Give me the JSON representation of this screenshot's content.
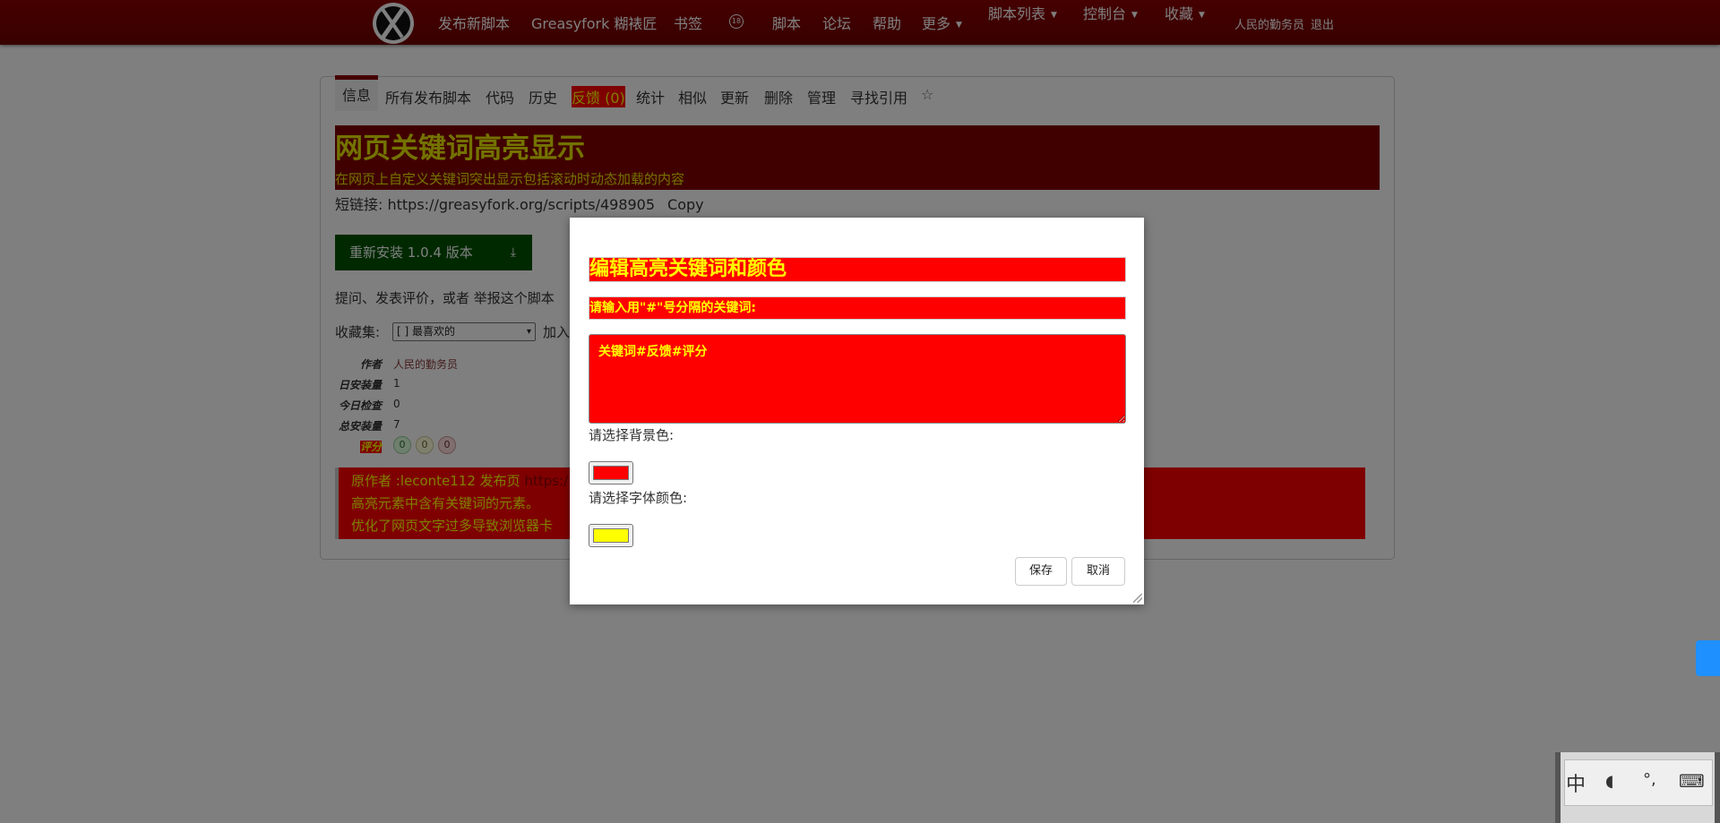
{
  "nav": {
    "items": [
      "发布新脚本",
      "Greasyfork 糊裱匠",
      "书签",
      "脚本",
      "论坛",
      "帮助",
      "更多"
    ],
    "dropdowns": [
      "脚本列表",
      "控制台",
      "收藏"
    ],
    "caret": "▼",
    "user": "人民的勤务员",
    "logout": "退出"
  },
  "tabs": [
    "信息",
    "所有发布脚本",
    "代码",
    "历史",
    "反馈 (0)",
    "统计",
    "相似",
    "更新",
    "删除",
    "管理",
    "寻找引用",
    "☆"
  ],
  "script": {
    "title": "网页关键词高亮显示",
    "subtitle": "在网页上自定义关键词突出显示包括滚动时动态加载的内容",
    "shortlink_label": "短链接: https://greasyfork.org/scripts/498905",
    "copy": "Copy",
    "install": "重新安装 1.0.4 版本",
    "feedback_line": "提问、发表评价，或者 举报这个脚本",
    "collections_label": "收藏集:",
    "collections_value": "[ ] 最喜欢的",
    "collections_add": "加入",
    "meta": {
      "author_k": "作者",
      "author_v": "人民的勤务员",
      "daily_k": "日安装量",
      "daily_v": "1",
      "checks_k": "今日检查",
      "checks_v": "0",
      "total_k": "总安装量",
      "total_v": "7",
      "rating_k": "评分"
    },
    "ratings": [
      "0",
      "0",
      "0"
    ],
    "description": {
      "line1": "原作者 :leconte112 发布页 ",
      "line1_link": "https:/",
      "line2": "高亮元素中含有关键词的元素。",
      "line3": "优化了网页文字过多导致浏览器卡"
    }
  },
  "dialog": {
    "title": "编辑高亮关键词和颜色",
    "prompt": "请输入用\"#\"号分隔的关键词:",
    "keywords": "关键词#反馈#评分",
    "bg_label": "请选择背景色:",
    "bg_color": "#ff0000",
    "fg_label": "请选择字体颜色:",
    "fg_color": "#ffff00",
    "save": "保存",
    "cancel": "取消"
  },
  "ime": {
    "keys": [
      "中",
      "◖",
      "°,",
      "⌨"
    ]
  },
  "colors": {
    "brand": "#8b0000",
    "highlight_bg": "#ff0000",
    "highlight_fg": "#ffff00",
    "install": "#005200"
  }
}
